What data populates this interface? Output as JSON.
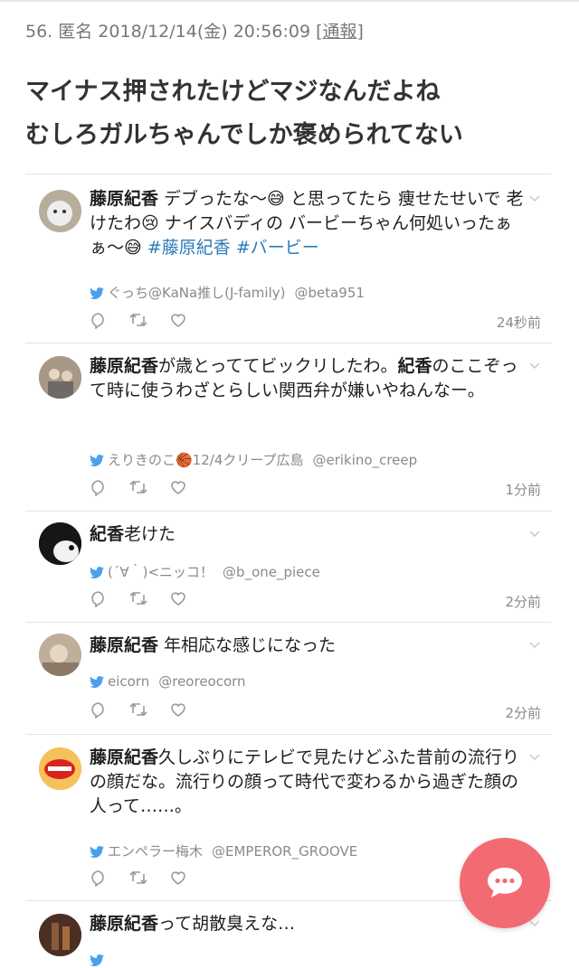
{
  "comment": {
    "number": "56.",
    "name": "匿名",
    "datetime": "2018/12/14(金) 20:56:09",
    "report_label": "通報",
    "body_line1": "マイナス押されたけどマジなんだよね",
    "body_line2": "むしろガルちゃんでしか褒められてない"
  },
  "tweets": [
    {
      "bold1": "藤原紀香",
      "text": " デブったな〜😅 と思ってたら 痩せたせいで 老けたわ😢 ナイスバディの バービーちゃん何処いったぁぁ〜😅 ",
      "tag1": "#藤原紀香",
      "tag2": " #バービー",
      "author_name": "ぐっち@KaNa推し(J-family)",
      "handle": "@beta951",
      "time": "24秒前"
    },
    {
      "bold1": "藤原紀香",
      "text": "が歳とっててビックリしたわ。",
      "bold2": "紀香",
      "text2": "のここぞって時に使うわざとらしい関西弁が嫌いやねんなー。",
      "author_name": "えりきのこ🏀12/4クリープ広島",
      "handle": "@erikino_creep",
      "time": "1分前"
    },
    {
      "bold1": "紀香",
      "text": "老けた",
      "author_name": "(´∀｀)<ニッコ！",
      "handle": "@b_one_piece",
      "time": "2分前"
    },
    {
      "bold1": "藤原紀香",
      "text": " 年相応な感じになった",
      "author_name": "eicorn",
      "handle": "@reoreocorn",
      "time": "2分前"
    },
    {
      "bold1": "藤原紀香",
      "text": "久しぶりにテレビで見たけどふた昔前の流行りの顔だな。流行りの顔って時代で変わるから過ぎた顔の人って……。",
      "author_name": "エンペラー梅木",
      "handle": "@EMPEROR_GROOVE",
      "time": ""
    },
    {
      "bold1": "藤原紀香",
      "text": "って胡散臭えな…",
      "author_name": "",
      "handle": "",
      "time": ""
    }
  ],
  "icons": {
    "bird": "twitter-bird-icon",
    "reply": "reply-icon",
    "retweet": "retweet-icon",
    "like": "heart-icon",
    "chevron": "chevron-down-icon",
    "fab": "chat-bubble-icon"
  },
  "colors": {
    "accent": "#f26b72",
    "link": "#2b7bb9",
    "muted": "#8a8a8a"
  }
}
